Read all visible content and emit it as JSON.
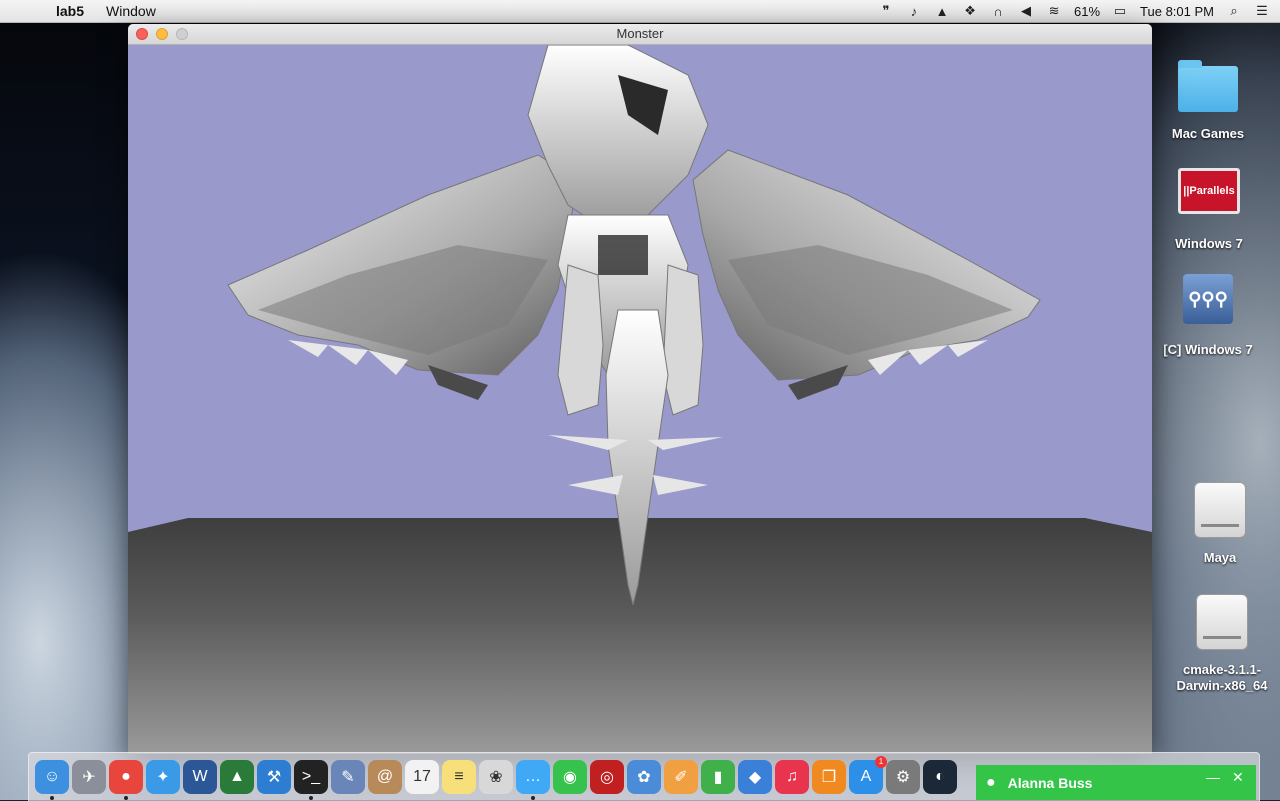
{
  "menubar": {
    "apple": "",
    "app_name": "lab5",
    "menus": [
      "Window"
    ],
    "battery": "61%",
    "clock": "Tue 8:01 PM",
    "status_icons": [
      "hangouts-icon",
      "bell-icon",
      "google-drive-icon",
      "dropbox-icon",
      "headphones-icon",
      "volume-icon",
      "wifi-icon",
      "battery-icon",
      "spotlight-icon",
      "notification-center-icon"
    ]
  },
  "window": {
    "title": "Monster"
  },
  "desktop": {
    "icons": [
      {
        "label": "Mac Games"
      },
      {
        "label": "Windows 7",
        "badge_text": "||Parallels"
      },
      {
        "label": "[C] Windows 7"
      },
      {
        "label": "Maya"
      },
      {
        "label": "cmake-3.1.1-Darwin-x86_64"
      }
    ]
  },
  "dock": {
    "items": [
      {
        "name": "finder-icon",
        "color": "#3d8fe0",
        "glyph": "☺",
        "running": true
      },
      {
        "name": "launchpad-icon",
        "color": "#8a8f99",
        "glyph": "✈",
        "running": false
      },
      {
        "name": "chrome-icon",
        "color": "#e8453c",
        "glyph": "●",
        "running": true
      },
      {
        "name": "safari-icon",
        "color": "#3a9ae8",
        "glyph": "✦",
        "running": false
      },
      {
        "name": "word-icon",
        "color": "#2b5797",
        "glyph": "W",
        "running": false
      },
      {
        "name": "cmake-gui-icon",
        "color": "#2a7a3a",
        "glyph": "▲",
        "running": false
      },
      {
        "name": "xcode-icon",
        "color": "#2d7dd2",
        "glyph": "⚒",
        "running": false
      },
      {
        "name": "terminal-icon",
        "color": "#222222",
        "glyph": ">_",
        "running": true
      },
      {
        "name": "preview-icon",
        "color": "#6a86b8",
        "glyph": "✎",
        "running": false
      },
      {
        "name": "contacts-icon",
        "color": "#b88a5a",
        "glyph": "@",
        "running": false
      },
      {
        "name": "calendar-icon",
        "color": "#f2f2f2",
        "glyph": "17",
        "running": false
      },
      {
        "name": "notes-icon",
        "color": "#f7e07a",
        "glyph": "≡",
        "running": false
      },
      {
        "name": "photos-icon",
        "color": "#d8d8d8",
        "glyph": "❀",
        "running": false
      },
      {
        "name": "messages-icon",
        "color": "#3fa9f5",
        "glyph": "…",
        "running": true
      },
      {
        "name": "facetime-icon",
        "color": "#36c24c",
        "glyph": "◉",
        "running": false
      },
      {
        "name": "photo-booth-icon",
        "color": "#c02020",
        "glyph": "◎",
        "running": false
      },
      {
        "name": "iphoto-icon",
        "color": "#4a8cd8",
        "glyph": "✿",
        "running": false
      },
      {
        "name": "pages-icon",
        "color": "#f0a040",
        "glyph": "✐",
        "running": false
      },
      {
        "name": "numbers-icon",
        "color": "#3fb04a",
        "glyph": "▮",
        "running": false
      },
      {
        "name": "keynote-icon",
        "color": "#3a7fd8",
        "glyph": "◆",
        "running": false
      },
      {
        "name": "itunes-icon",
        "color": "#e8344c",
        "glyph": "♫",
        "running": false
      },
      {
        "name": "ibooks-icon",
        "color": "#f08a20",
        "glyph": "❐",
        "running": false
      },
      {
        "name": "app-store-icon",
        "color": "#2c8fe8",
        "glyph": "A",
        "running": false,
        "badge": "1"
      },
      {
        "name": "system-preferences-icon",
        "color": "#7a7a7a",
        "glyph": "⚙",
        "running": false
      },
      {
        "name": "steam-icon",
        "color": "#1b2838",
        "glyph": "◐",
        "running": false
      }
    ]
  },
  "notification": {
    "name": "Alanna Buss",
    "minimize": "—",
    "close": "✕"
  }
}
